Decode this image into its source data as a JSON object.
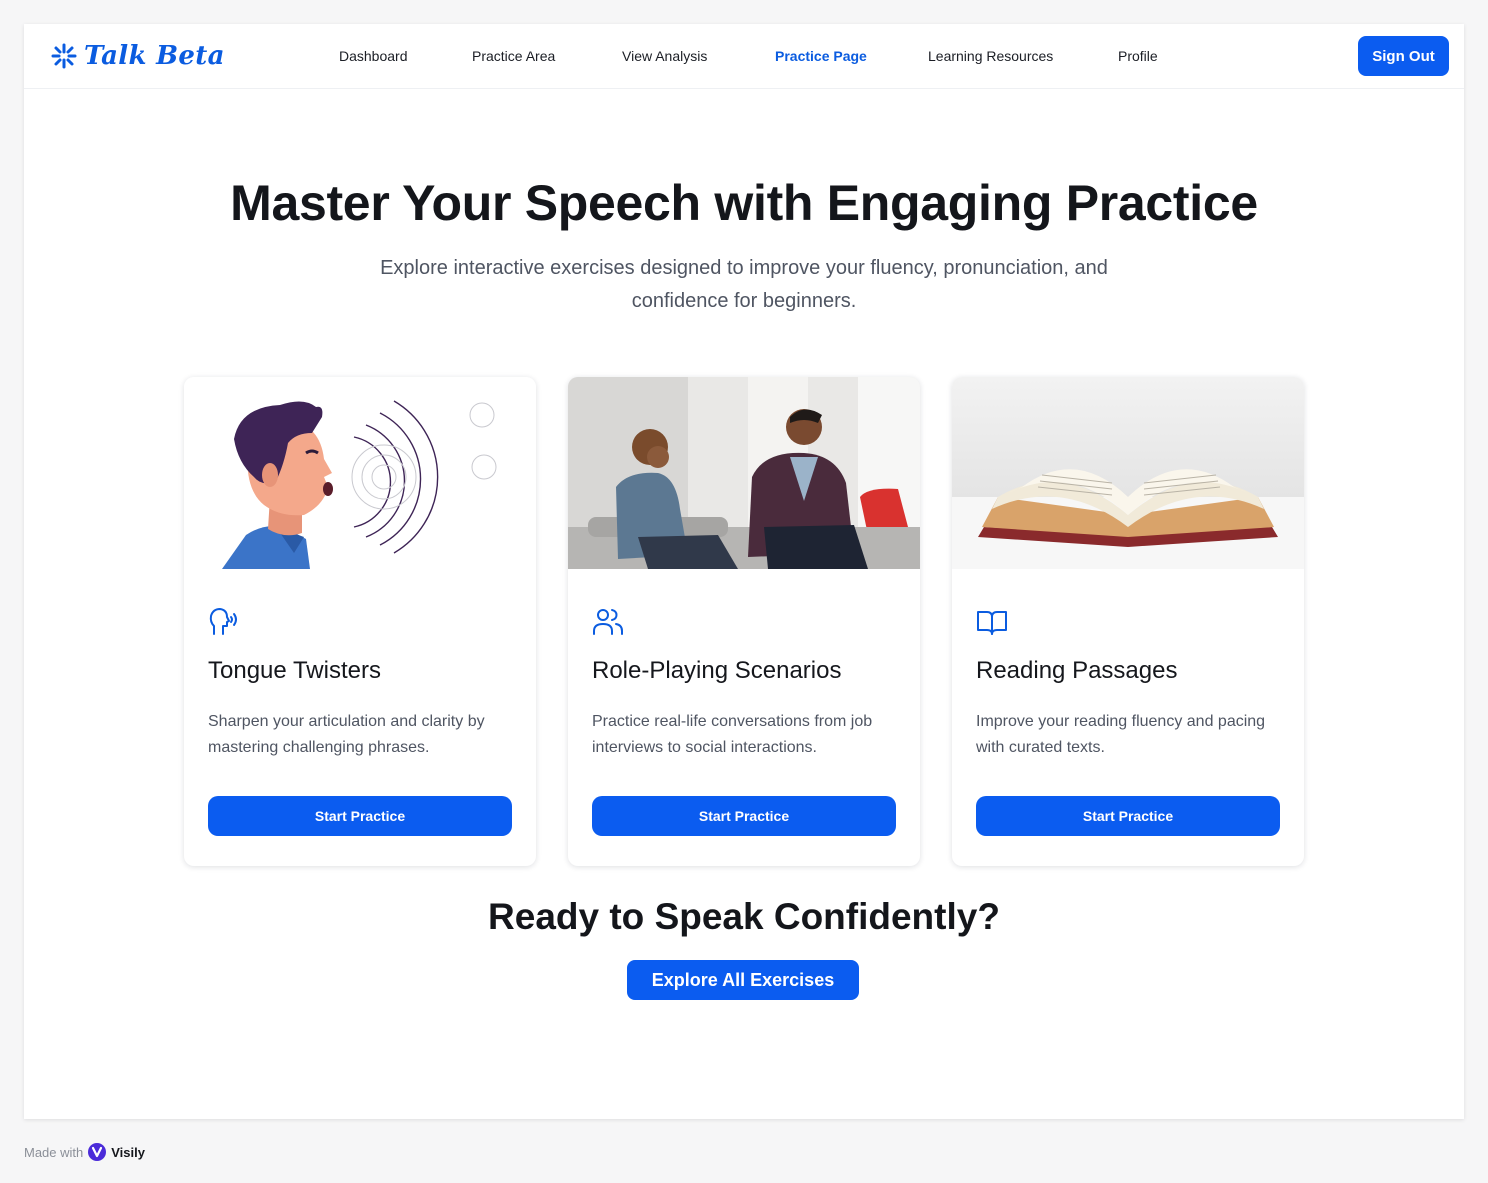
{
  "brand": {
    "name": "Talk Beta",
    "logo_icon": "asterisk-burst-icon",
    "color": "#0b5ce0"
  },
  "nav": {
    "items": [
      {
        "label": "Dashboard",
        "active": false
      },
      {
        "label": "Practice Area",
        "active": false
      },
      {
        "label": "View Analysis",
        "active": false
      },
      {
        "label": "Practice Page",
        "active": true
      },
      {
        "label": "Learning Resources",
        "active": false
      },
      {
        "label": "Profile",
        "active": false
      }
    ],
    "sign_out": "Sign Out"
  },
  "hero": {
    "title": "Master Your Speech with Engaging Practice",
    "subtitle": "Explore interactive exercises designed to improve your fluency, pronunciation, and confidence for beginners."
  },
  "cards": [
    {
      "icon": "speaking-head-icon",
      "title": "Tongue Twisters",
      "description": "Sharpen your articulation and clarity by mastering challenging phrases.",
      "button": "Start Practice"
    },
    {
      "icon": "users-icon",
      "title": "Role-Playing Scenarios",
      "description": "Practice real-life conversations from job interviews to social interactions.",
      "button": "Start Practice"
    },
    {
      "icon": "open-book-icon",
      "title": "Reading Passages",
      "description": "Improve your reading fluency and pacing with curated texts.",
      "button": "Start Practice"
    }
  ],
  "cta": {
    "title": "Ready to Speak Confidently?",
    "button": "Explore All Exercises"
  },
  "footer": {
    "made_with": "Made with",
    "tool": "Visily"
  },
  "colors": {
    "accent": "#0b5cf0",
    "text": "#15171c",
    "muted": "#4f5562"
  }
}
